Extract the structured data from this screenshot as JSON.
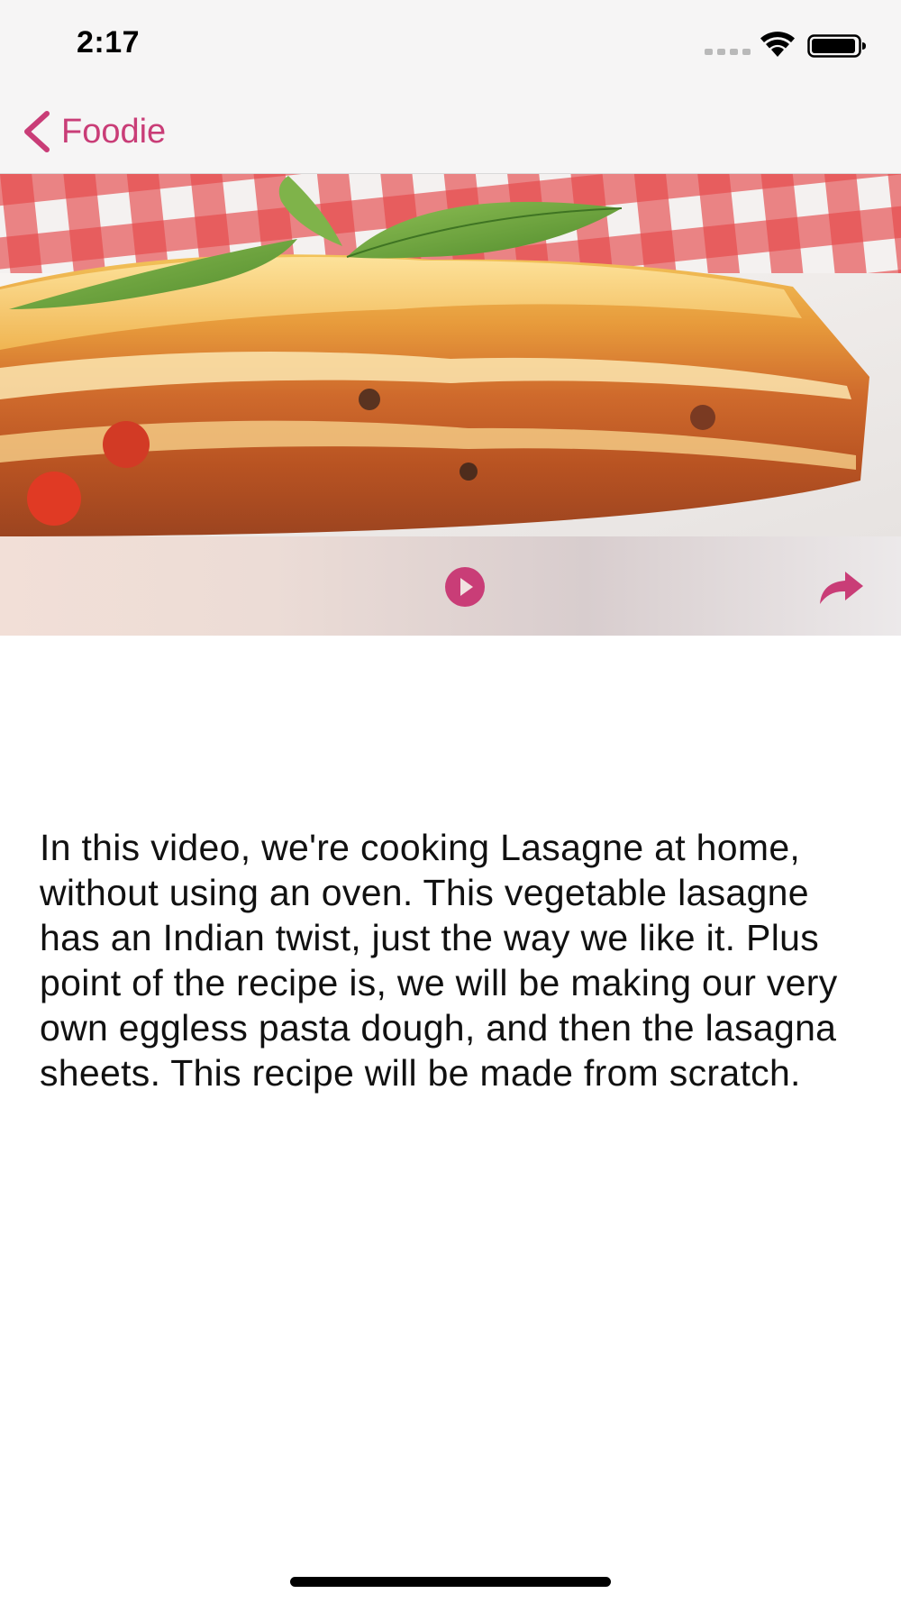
{
  "status_bar": {
    "time": "2:17"
  },
  "nav": {
    "back_label": "Foodie"
  },
  "hero": {
    "image_subject": "lasagne-slice-with-basil"
  },
  "media_bar": {
    "play_icon": "play-icon",
    "share_icon": "share-icon"
  },
  "description": {
    "text": "In this video, we're cooking Lasagne at home, without using an oven. This vegetable lasagne has an Indian twist, just the way we like it. Plus point of the recipe is, we will be making our very own eggless pasta dough, and then the lasagna sheets. This recipe will be made from scratch."
  },
  "colors": {
    "accent": "#c93d77",
    "nav_background": "#f6f5f5",
    "text": "#111111"
  }
}
